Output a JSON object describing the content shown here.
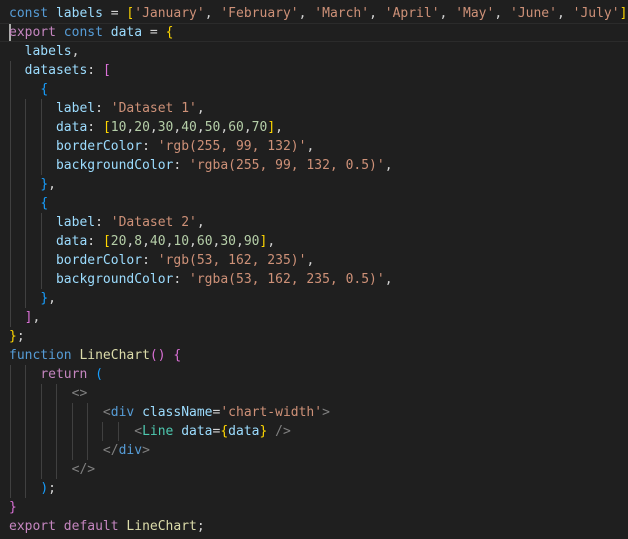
{
  "editor": {
    "language": "javascript-jsx",
    "lines": [
      [
        [
          "kw",
          "const"
        ],
        [
          "pun",
          " "
        ],
        [
          "var",
          "labels"
        ],
        [
          "pun",
          " = "
        ],
        [
          "b1",
          "["
        ],
        [
          "str",
          "'January'"
        ],
        [
          "pun",
          ", "
        ],
        [
          "str",
          "'February'"
        ],
        [
          "pun",
          ", "
        ],
        [
          "str",
          "'March'"
        ],
        [
          "pun",
          ", "
        ],
        [
          "str",
          "'April'"
        ],
        [
          "pun",
          ", "
        ],
        [
          "str",
          "'May'"
        ],
        [
          "pun",
          ", "
        ],
        [
          "str",
          "'June'"
        ],
        [
          "pun",
          ", "
        ],
        [
          "str",
          "'July'"
        ],
        [
          "b1",
          "]"
        ],
        [
          "pun",
          ";"
        ]
      ],
      [
        [
          "ctl",
          "export"
        ],
        [
          "pun",
          " "
        ],
        [
          "kw",
          "const"
        ],
        [
          "pun",
          " "
        ],
        [
          "var",
          "data"
        ],
        [
          "pun",
          " = "
        ],
        [
          "b1",
          "{"
        ]
      ],
      [
        [
          "pun",
          "  "
        ],
        [
          "var",
          "labels"
        ],
        [
          "pun",
          ","
        ]
      ],
      [
        [
          "pun",
          "  "
        ],
        [
          "var",
          "datasets"
        ],
        [
          "pun",
          ": "
        ],
        [
          "b2",
          "["
        ]
      ],
      [
        [
          "pun",
          "    "
        ],
        [
          "b3",
          "{"
        ]
      ],
      [
        [
          "pun",
          "      "
        ],
        [
          "var",
          "label"
        ],
        [
          "pun",
          ": "
        ],
        [
          "str",
          "'Dataset 1'"
        ],
        [
          "pun",
          ","
        ]
      ],
      [
        [
          "pun",
          "      "
        ],
        [
          "var",
          "data"
        ],
        [
          "pun",
          ": "
        ],
        [
          "b1",
          "["
        ],
        [
          "num",
          "10"
        ],
        [
          "pun",
          ","
        ],
        [
          "num",
          "20"
        ],
        [
          "pun",
          ","
        ],
        [
          "num",
          "30"
        ],
        [
          "pun",
          ","
        ],
        [
          "num",
          "40"
        ],
        [
          "pun",
          ","
        ],
        [
          "num",
          "50"
        ],
        [
          "pun",
          ","
        ],
        [
          "num",
          "60"
        ],
        [
          "pun",
          ","
        ],
        [
          "num",
          "70"
        ],
        [
          "b1",
          "]"
        ],
        [
          "pun",
          ","
        ]
      ],
      [
        [
          "pun",
          "      "
        ],
        [
          "var",
          "borderColor"
        ],
        [
          "pun",
          ": "
        ],
        [
          "str",
          "'rgb(255, 99, 132)'"
        ],
        [
          "pun",
          ","
        ]
      ],
      [
        [
          "pun",
          "      "
        ],
        [
          "var",
          "backgroundColor"
        ],
        [
          "pun",
          ": "
        ],
        [
          "str",
          "'rgba(255, 99, 132, 0.5)'"
        ],
        [
          "pun",
          ","
        ]
      ],
      [
        [
          "pun",
          "    "
        ],
        [
          "b3",
          "}"
        ],
        [
          "pun",
          ","
        ]
      ],
      [
        [
          "pun",
          "    "
        ],
        [
          "b3",
          "{"
        ]
      ],
      [
        [
          "pun",
          "      "
        ],
        [
          "var",
          "label"
        ],
        [
          "pun",
          ": "
        ],
        [
          "str",
          "'Dataset 2'"
        ],
        [
          "pun",
          ","
        ]
      ],
      [
        [
          "pun",
          "      "
        ],
        [
          "var",
          "data"
        ],
        [
          "pun",
          ": "
        ],
        [
          "b1",
          "["
        ],
        [
          "num",
          "20"
        ],
        [
          "pun",
          ","
        ],
        [
          "num",
          "8"
        ],
        [
          "pun",
          ","
        ],
        [
          "num",
          "40"
        ],
        [
          "pun",
          ","
        ],
        [
          "num",
          "10"
        ],
        [
          "pun",
          ","
        ],
        [
          "num",
          "60"
        ],
        [
          "pun",
          ","
        ],
        [
          "num",
          "30"
        ],
        [
          "pun",
          ","
        ],
        [
          "num",
          "90"
        ],
        [
          "b1",
          "]"
        ],
        [
          "pun",
          ","
        ]
      ],
      [
        [
          "pun",
          "      "
        ],
        [
          "var",
          "borderColor"
        ],
        [
          "pun",
          ": "
        ],
        [
          "str",
          "'rgb(53, 162, 235)'"
        ],
        [
          "pun",
          ","
        ]
      ],
      [
        [
          "pun",
          "      "
        ],
        [
          "var",
          "backgroundColor"
        ],
        [
          "pun",
          ": "
        ],
        [
          "str",
          "'rgba(53, 162, 235, 0.5)'"
        ],
        [
          "pun",
          ","
        ]
      ],
      [
        [
          "pun",
          "    "
        ],
        [
          "b3",
          "}"
        ],
        [
          "pun",
          ","
        ]
      ],
      [
        [
          "pun",
          "  "
        ],
        [
          "b2",
          "]"
        ],
        [
          "pun",
          ","
        ]
      ],
      [
        [
          "b1",
          "}"
        ],
        [
          "pun",
          ";"
        ]
      ],
      [
        [
          "kw",
          "function"
        ],
        [
          "pun",
          " "
        ],
        [
          "fn",
          "LineChart"
        ],
        [
          "b2",
          "()"
        ],
        [
          "pun",
          " "
        ],
        [
          "b2",
          "{"
        ]
      ],
      [
        [
          "pun",
          "    "
        ],
        [
          "ctl",
          "return"
        ],
        [
          "pun",
          " "
        ],
        [
          "b3",
          "("
        ]
      ],
      [
        [
          "pun",
          "        "
        ],
        [
          "tag",
          "<>"
        ]
      ],
      [
        [
          "pun",
          "            "
        ],
        [
          "tag",
          "<"
        ],
        [
          "tagn",
          "div"
        ],
        [
          "pun",
          " "
        ],
        [
          "attr",
          "className"
        ],
        [
          "pun",
          "="
        ],
        [
          "str",
          "'chart-width'"
        ],
        [
          "tag",
          ">"
        ]
      ],
      [
        [
          "pun",
          "                "
        ],
        [
          "tag",
          "<"
        ],
        [
          "comp",
          "Line"
        ],
        [
          "pun",
          " "
        ],
        [
          "attr",
          "data"
        ],
        [
          "pun",
          "="
        ],
        [
          "b1",
          "{"
        ],
        [
          "var",
          "data"
        ],
        [
          "b1",
          "}"
        ],
        [
          "pun",
          " "
        ],
        [
          "tag",
          "/>"
        ]
      ],
      [
        [
          "pun",
          "            "
        ],
        [
          "tag",
          "</"
        ],
        [
          "tagn",
          "div"
        ],
        [
          "tag",
          ">"
        ]
      ],
      [
        [
          "pun",
          "        "
        ],
        [
          "tag",
          "</>"
        ]
      ],
      [
        [
          "pun",
          "    "
        ],
        [
          "b3",
          ")"
        ],
        [
          "pun",
          ";"
        ]
      ],
      [
        [
          "b2",
          "}"
        ]
      ],
      [
        [
          "ctl",
          "export"
        ],
        [
          "pun",
          " "
        ],
        [
          "ctl",
          "default"
        ],
        [
          "pun",
          " "
        ],
        [
          "fn",
          "LineChart"
        ],
        [
          "pun",
          ";"
        ]
      ]
    ]
  }
}
